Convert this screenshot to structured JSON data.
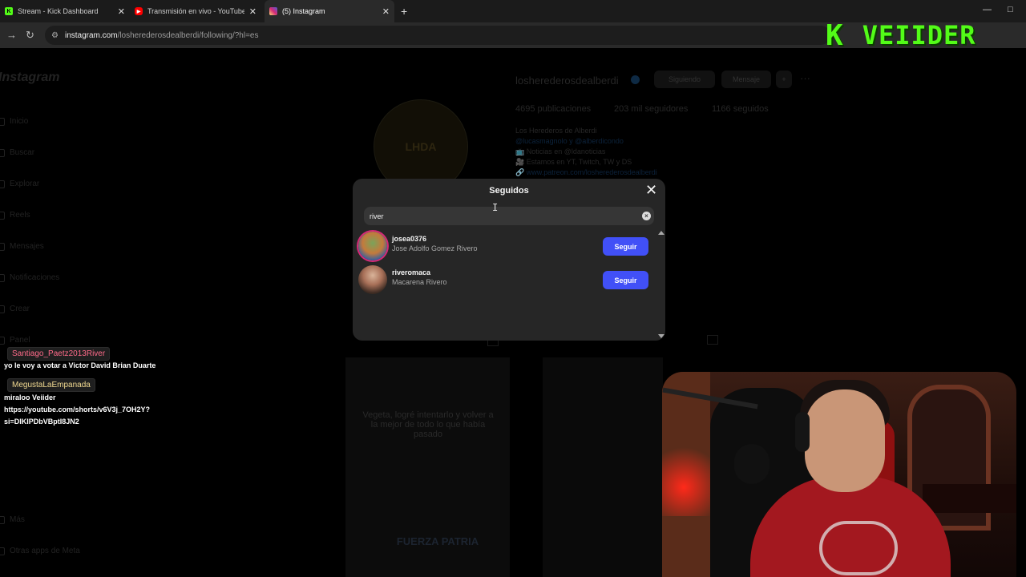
{
  "browser": {
    "tabs": [
      {
        "title": "Stream - Kick Dashboard",
        "icon": "kick-icon",
        "color": "#53fc18",
        "active": false
      },
      {
        "title": "Transmisión en vivo - YouTube",
        "icon": "youtube-icon",
        "color": "#ff0000",
        "active": false
      },
      {
        "title": "(5) Instagram",
        "icon": "instagram-icon",
        "color": "#d6249f",
        "active": true
      }
    ],
    "new_tab": "+",
    "minimize": "—",
    "maximize": "□",
    "url_host": "instagram.com",
    "url_path": "/losherederosdealberdi/following/?hl=es"
  },
  "stream_overlay": {
    "logo_k": "K",
    "logo_name": "VEIIDER"
  },
  "instagram_page": {
    "logo": "Instagram",
    "nav": [
      "Inicio",
      "Buscar",
      "Explorar",
      "Reels",
      "Mensajes",
      "Notificaciones",
      "Crear",
      "Panel",
      "Más",
      "Otras apps de Meta"
    ],
    "profile": {
      "username": "losherederosdealberdi",
      "following_button": "Siguiendo",
      "message_button": "Mensaje",
      "posts": "4695 publicaciones",
      "followers": "203 mil seguidores",
      "following": "1166 seguidos",
      "bio": [
        "Los Herederos de Alberdi",
        "@lucasmagnolo y @alberdicondo",
        "📺 Noticias en @ldanoticias",
        "🎥 Estamos en YT, Twitch, TW y DS",
        "🔗 www.patreon.com/losherederosdealberdi"
      ],
      "avatar_text": "LHDA"
    },
    "post_texts": [
      "Vegeta, logré intentarlo y volver a la mejor de todo lo que había pasado",
      "FUERZA PATRIA"
    ]
  },
  "modal": {
    "title": "Seguidos",
    "search_value": "river",
    "clear_icon": "×",
    "close_icon": "✕",
    "results": [
      {
        "username": "josea0376",
        "full_name": "Jose Adolfo Gomez Rivero",
        "button": "Seguir"
      },
      {
        "username": "riveromaca",
        "full_name": "Macarena Rivero",
        "button": "Seguir"
      }
    ]
  },
  "chat": [
    {
      "user": "Santiago_Paetz2013River",
      "user_color": "#ff6b8a",
      "lines": [
        "yo le voy a votar a Victor David Brian Duarte"
      ]
    },
    {
      "user": "MegustaLaEmpanada",
      "user_color": "#f0d890",
      "lines": [
        "miraloo Veiider",
        "https://youtube.com/shorts/v6V3j_7OH2Y?",
        "si=DIKIPDbVBptI8JN2"
      ]
    }
  ],
  "colors": {
    "modal_bg": "#262626",
    "search_bg": "#363636",
    "follow_button": "#4150f7",
    "kick_green": "#53fc18"
  }
}
